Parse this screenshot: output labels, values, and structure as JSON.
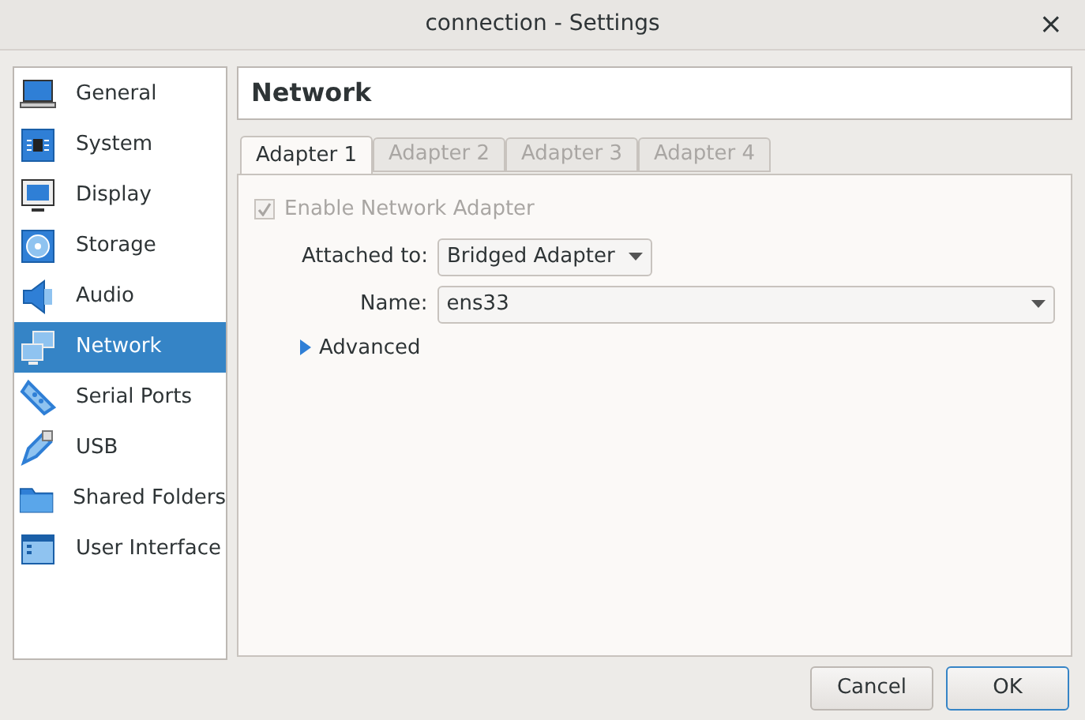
{
  "window": {
    "title": "connection - Settings",
    "close": "×"
  },
  "sidebar": {
    "items": [
      {
        "label": "General",
        "kind": "laptop",
        "selected": false
      },
      {
        "label": "System",
        "kind": "chip",
        "selected": false
      },
      {
        "label": "Display",
        "kind": "monitor",
        "selected": false
      },
      {
        "label": "Storage",
        "kind": "disc",
        "selected": false
      },
      {
        "label": "Audio",
        "kind": "speaker",
        "selected": false
      },
      {
        "label": "Network",
        "kind": "network",
        "selected": true
      },
      {
        "label": "Serial Ports",
        "kind": "plug",
        "selected": false
      },
      {
        "label": "USB",
        "kind": "usb",
        "selected": false
      },
      {
        "label": "Shared Folders",
        "kind": "folder",
        "selected": false
      },
      {
        "label": "User Interface",
        "kind": "window",
        "selected": false
      }
    ]
  },
  "page": {
    "title": "Network",
    "tabs": [
      {
        "label": "Adapter 1",
        "selected": true,
        "disabled": false
      },
      {
        "label": "Adapter 2",
        "selected": false,
        "disabled": true
      },
      {
        "label": "Adapter 3",
        "selected": false,
        "disabled": true
      },
      {
        "label": "Adapter 4",
        "selected": false,
        "disabled": true
      }
    ],
    "enable": {
      "label": "Enable Network Adapter",
      "checked": true,
      "disabled": true
    },
    "attached_to": {
      "label": "Attached to:",
      "value": "Bridged Adapter"
    },
    "name": {
      "label": "Name:",
      "value": "ens33"
    },
    "advanced": {
      "label": "Advanced",
      "expanded": false
    }
  },
  "buttons": [
    {
      "label": "Cancel",
      "kind": "default"
    },
    {
      "label": "OK",
      "kind": "primary"
    }
  ]
}
